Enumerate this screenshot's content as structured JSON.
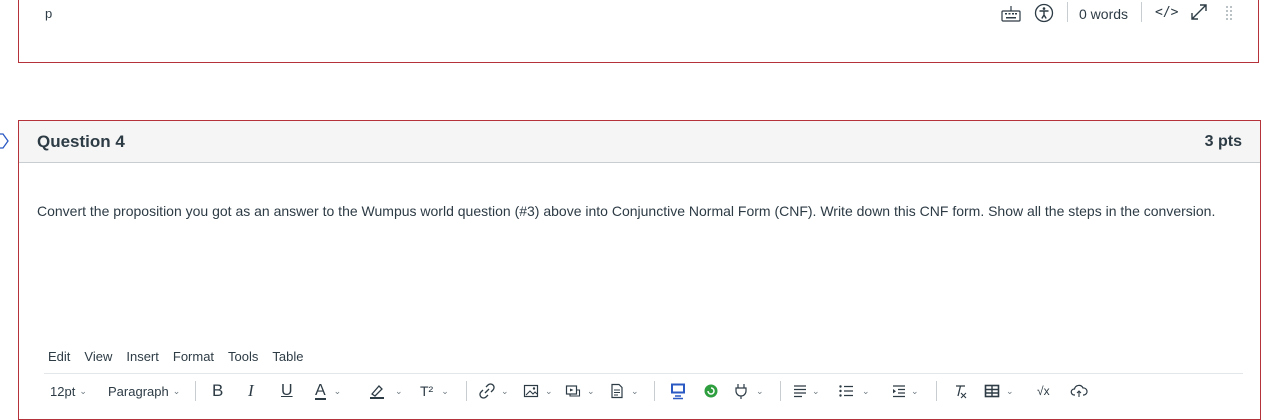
{
  "previous_editor": {
    "path_label": "p",
    "word_count": "0 words",
    "html_toggle": "</>"
  },
  "question": {
    "title": "Question 4",
    "points": "3 pts",
    "text": "Convert the proposition you got as an answer to the Wumpus world question (#3) above into Conjunctive Normal Form (CNF). Write down this CNF form. Show all the steps in the conversion."
  },
  "editor": {
    "menu": [
      "Edit",
      "View",
      "Insert",
      "Format",
      "Tools",
      "Table"
    ],
    "font_size": "12pt",
    "block_format": "Paragraph",
    "bold": "B",
    "italic": "I",
    "underline": "U",
    "text_color": "A",
    "superscript": "T²",
    "math": "√x"
  },
  "colors": {
    "border_accent": "#b5323a",
    "text": "#2d3b45",
    "header_bg": "#f5f5f5",
    "apps_green": "#2e9e3f",
    "embed_blue": "#2b59c3"
  }
}
